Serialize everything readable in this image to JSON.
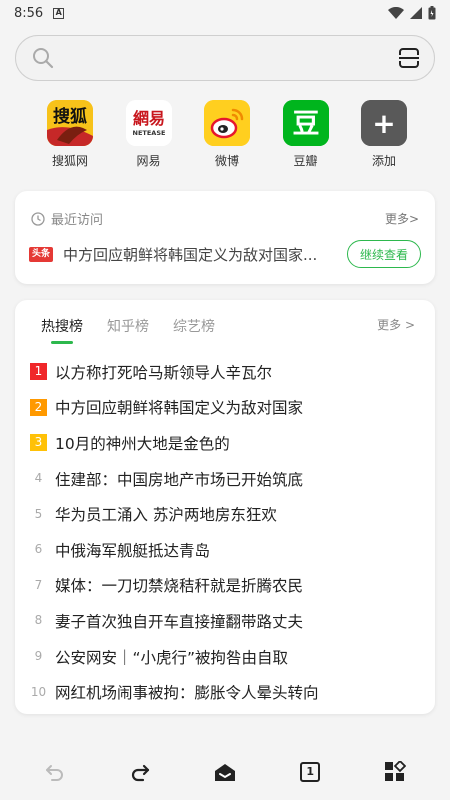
{
  "status": {
    "time": "8:56",
    "notif": "A"
  },
  "search": {
    "placeholder": ""
  },
  "quick_links": [
    {
      "label": "搜狐网",
      "icon": "sohu-icon",
      "text": "搜狐"
    },
    {
      "label": "网易",
      "icon": "netease-icon",
      "text": "網易",
      "sub": "NETEASE"
    },
    {
      "label": "微博",
      "icon": "weibo-icon"
    },
    {
      "label": "豆瓣",
      "icon": "douban-icon",
      "text": "豆"
    },
    {
      "label": "添加",
      "icon": "plus-icon",
      "text": "+"
    }
  ],
  "recent": {
    "title": "最近访问",
    "more": "更多>",
    "source": "头条",
    "item": "中方回应朝鲜将韩国定义为敌对国家...",
    "button": "继续查看"
  },
  "hot": {
    "tabs": [
      "热搜榜",
      "知乎榜",
      "综艺榜"
    ],
    "more": "更多 >",
    "items": [
      {
        "rank": "1",
        "text": "以方称打死哈马斯领导人辛瓦尔"
      },
      {
        "rank": "2",
        "text": "中方回应朝鲜将韩国定义为敌对国家"
      },
      {
        "rank": "3",
        "text": "10月的神州大地是金色的"
      },
      {
        "rank": "4",
        "text": "住建部：中国房地产市场已开始筑底"
      },
      {
        "rank": "5",
        "text": "华为员工涌入 苏沪两地房东狂欢"
      },
      {
        "rank": "6",
        "text": "中俄海军舰艇抵达青岛"
      },
      {
        "rank": "7",
        "text": "媒体：一刀切禁烧秸秆就是折腾农民"
      },
      {
        "rank": "8",
        "text": "妻子首次独自开车直接撞翻带路丈夫"
      },
      {
        "rank": "9",
        "text": "公安网安｜“小虎行”被拘咎由自取"
      },
      {
        "rank": "10",
        "text": "网红机场闹事被拘：膨胀令人晕头转向"
      }
    ]
  },
  "bottom": {
    "tab_count": "1"
  },
  "colors": {
    "accent": "#2db84d",
    "rank1": "#f0272a",
    "rank2": "#ff9900",
    "rank3": "#ffc107"
  }
}
